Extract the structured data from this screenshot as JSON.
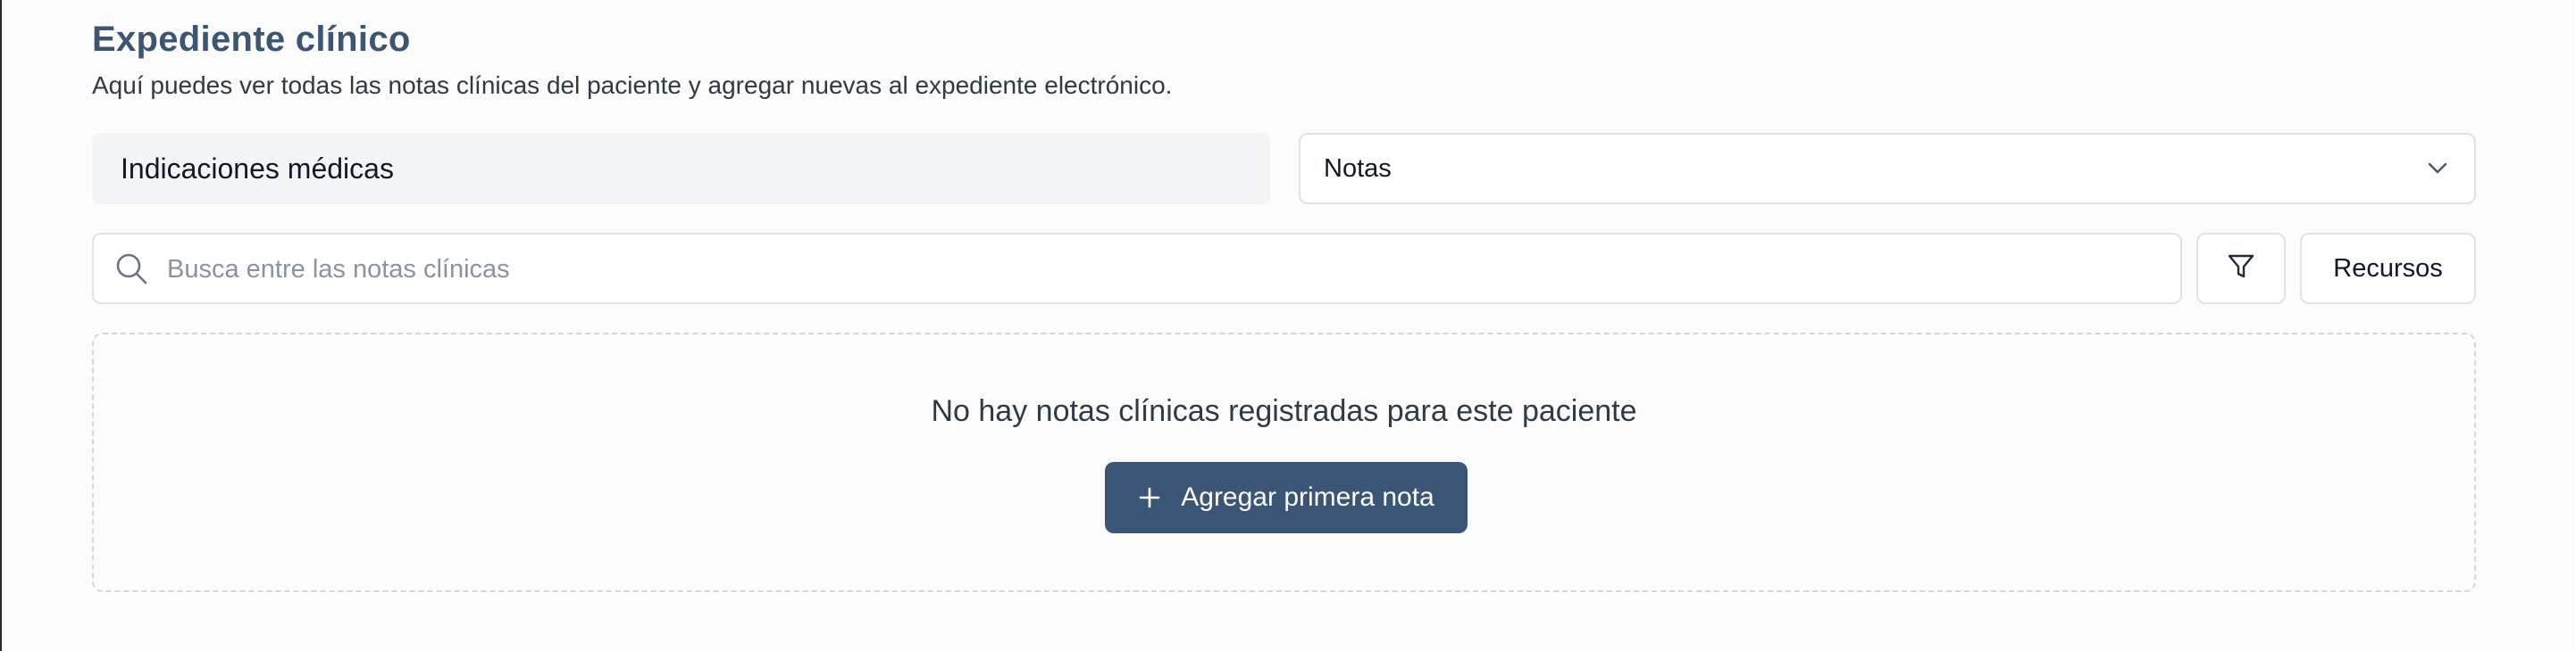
{
  "header": {
    "title": "Expediente clínico",
    "subtitle": "Aquí puedes ver todas las notas clínicas del paciente y agregar nuevas al expediente electrónico."
  },
  "section_tab": {
    "label": "Indicaciones médicas"
  },
  "type_select": {
    "selected": "Notas",
    "icon": "chevron-down-icon"
  },
  "search": {
    "placeholder": "Busca entre las notas clínicas",
    "value": "",
    "icon": "search-icon"
  },
  "toolbar": {
    "filter_icon": "filter-icon",
    "resources_label": "Recursos"
  },
  "empty_state": {
    "message": "No hay notas clínicas registradas para este paciente",
    "add_button_label": "Agregar primera nota",
    "add_icon": "plus-icon"
  },
  "colors": {
    "accent": "#3a5575",
    "title": "#3c5573",
    "tab_background": "#f3f4f6",
    "border": "#dfe2e6"
  }
}
